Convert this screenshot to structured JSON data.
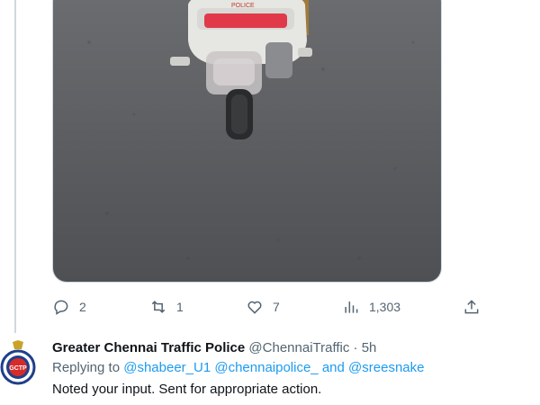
{
  "media": {
    "badge_text": "POLICE"
  },
  "actions": {
    "reply_count": "2",
    "retweet_count": "1",
    "like_count": "7",
    "views_count": "1,303"
  },
  "reply": {
    "author_name": "Greater Chennai Traffic Police",
    "author_handle": "@ChennaiTraffic",
    "separator": "·",
    "time": "5h",
    "avatar_text": "GCTP",
    "replying_prefix": "Replying to",
    "mention_1": "@shabeer_U1",
    "mention_2": "@chennaipolice_",
    "and_text": "and",
    "mention_3": "@sreesnake",
    "text": "Noted your input. Sent for appropriate action."
  },
  "colors": {
    "accent": "#1d9bf0",
    "muted": "#536471",
    "text": "#0f1419",
    "line": "#cfd9de"
  },
  "icons": [
    "reply-icon",
    "retweet-icon",
    "like-icon",
    "views-icon",
    "share-icon"
  ]
}
